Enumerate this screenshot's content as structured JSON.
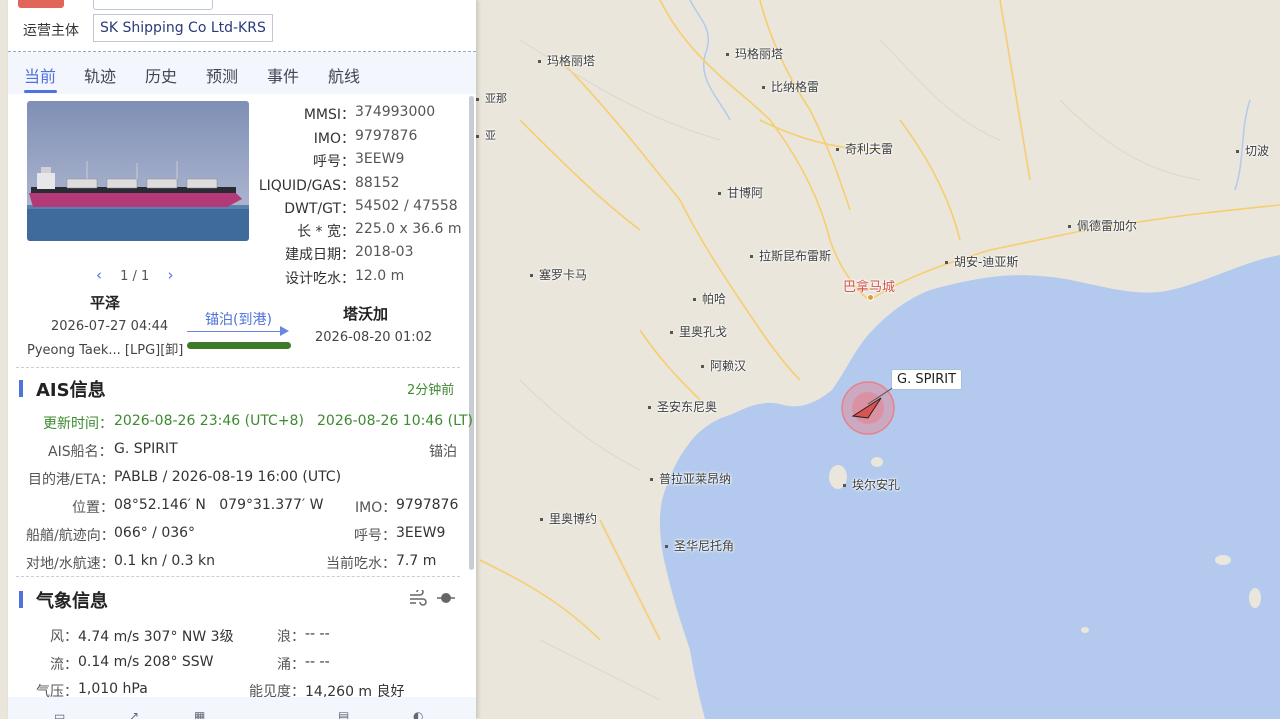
{
  "operator": {
    "label": "运营主体",
    "value": "SK Shipping Co Ltd-KRS"
  },
  "tabs": [
    "当前",
    "轨迹",
    "历史",
    "预测",
    "事件",
    "航线"
  ],
  "pager": {
    "prev": "‹",
    "page": "1 / 1",
    "next": "›"
  },
  "specs": [
    {
      "k": "MMSI：",
      "v": "374993000"
    },
    {
      "k": "IMO：",
      "v": "9797876"
    },
    {
      "k": "呼号：",
      "v": "3EEW9"
    },
    {
      "k": "LIQUID/GAS：",
      "v": "88152"
    },
    {
      "k": "DWT/GT：",
      "v": "54502 / 47558"
    },
    {
      "k": "长 * 宽：",
      "v": "225.0 x 36.6 m"
    },
    {
      "k": "建成日期：",
      "v": "2018-03"
    },
    {
      "k": "设计吃水：",
      "v": "12.0 m"
    }
  ],
  "voyage": {
    "from_port": "平泽",
    "from_time": "2026-07-27 04:44",
    "from_detail": "Pyeong Taek... [LPG][卸]",
    "status": "锚泊(到港)",
    "to_port": "塔沃加",
    "to_time": "2026-08-20 01:02",
    "progress": 1.0
  },
  "ais": {
    "title": "AIS信息",
    "ago": "2分钟前",
    "update_label": "更新时间：",
    "update_utc": "2026-08-26 23:46 (UTC+8)",
    "update_lt": "2026-08-26 10:46 (LT)",
    "name_label": "AIS船名：",
    "name_value": "G. SPIRIT",
    "nav_status": "锚泊",
    "dest_label": "目的港/ETA：",
    "dest_value": "PABLB / 2026-08-19 16:00 (UTC)",
    "pos_label": "位置：",
    "pos_value": "08°52.146′ N   079°31.377′ W",
    "imo_label": "IMO：",
    "imo_value": "9797876",
    "heading_label": "船艏/航迹向：",
    "heading_value": "066° / 036°",
    "callsign_label": "呼号：",
    "callsign_value": "3EEW9",
    "speed_label": "对地/水航速：",
    "speed_value": "0.1 kn / 0.3 kn",
    "draft_label": "当前吃水：",
    "draft_value": "7.7 m"
  },
  "weather": {
    "title": "气象信息",
    "wind_label": "风：",
    "wind_value": "4.74 m/s 307° NW 3级",
    "wave_label": "浪：",
    "wave_value": "-- --",
    "current_label": "流：",
    "current_value": "0.14 m/s 208° SSW",
    "swell_label": "涌：",
    "swell_value": "-- --",
    "pressure_label": "气压：",
    "pressure_value": "1,010 hPa",
    "visibility_label": "能见度：",
    "visibility_value": "14,260 m 良好"
  },
  "map": {
    "ship_label": "G. SPIRIT",
    "places": [
      "玛格丽塔",
      "玛格丽塔",
      "比纳格雷",
      "奇利夫雷",
      "切波",
      "甘博阿",
      "佩德雷加尔",
      "拉斯昆布雷斯",
      "胡安-迪亚斯",
      "塞罗卡马",
      "巴拿马城",
      "帕哈",
      "里奥孔戈",
      "阿赖汉",
      "圣安东尼奥",
      "普拉亚莱昂纳",
      "埃尔安孔",
      "里奥博约",
      "圣华尼托角",
      "亚那",
      "亚"
    ],
    "colors": {
      "land": "#eae6dc",
      "water": "#b3caee",
      "road": "#f6ce6e",
      "ship_ring": "#e8808a"
    }
  }
}
